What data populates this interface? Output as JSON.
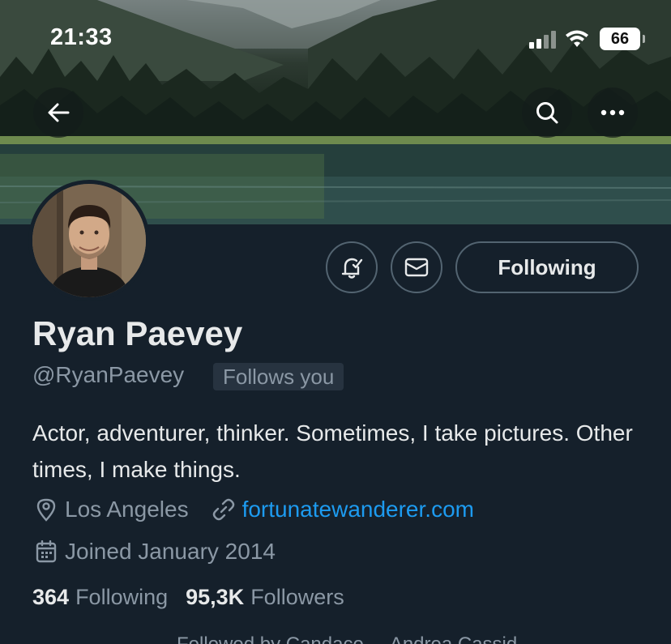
{
  "status_bar": {
    "time": "21:33",
    "battery": "66",
    "signal_icon": "cellular-signal-icon",
    "wifi_icon": "wifi-icon"
  },
  "header": {
    "back_icon": "arrow-left-icon",
    "search_icon": "search-icon",
    "more_icon": "more-horizontal-icon"
  },
  "profile": {
    "name": "Ryan Paevey",
    "handle": "@RyanPaevey",
    "follows_you": "Follows you",
    "bio": "Actor, adventurer, thinker. Sometimes, I take pictures. Other times, I make things.",
    "location": "Los Angeles",
    "website": "fortunatewanderer.com",
    "joined": "Joined January 2014",
    "following_count": "364",
    "following_label": "Following",
    "followers_count": "95,3K",
    "followers_label": "Followers",
    "followed_by": "Followed by Candace ... Andrea Cassid..."
  },
  "actions": {
    "notify_icon": "bell-check-icon",
    "message_icon": "envelope-icon",
    "following_button": "Following"
  },
  "colors": {
    "background": "#15202b",
    "text_primary": "#e7e9ea",
    "text_secondary": "#8b98a5",
    "link": "#1d9bf0",
    "border": "#536471"
  }
}
